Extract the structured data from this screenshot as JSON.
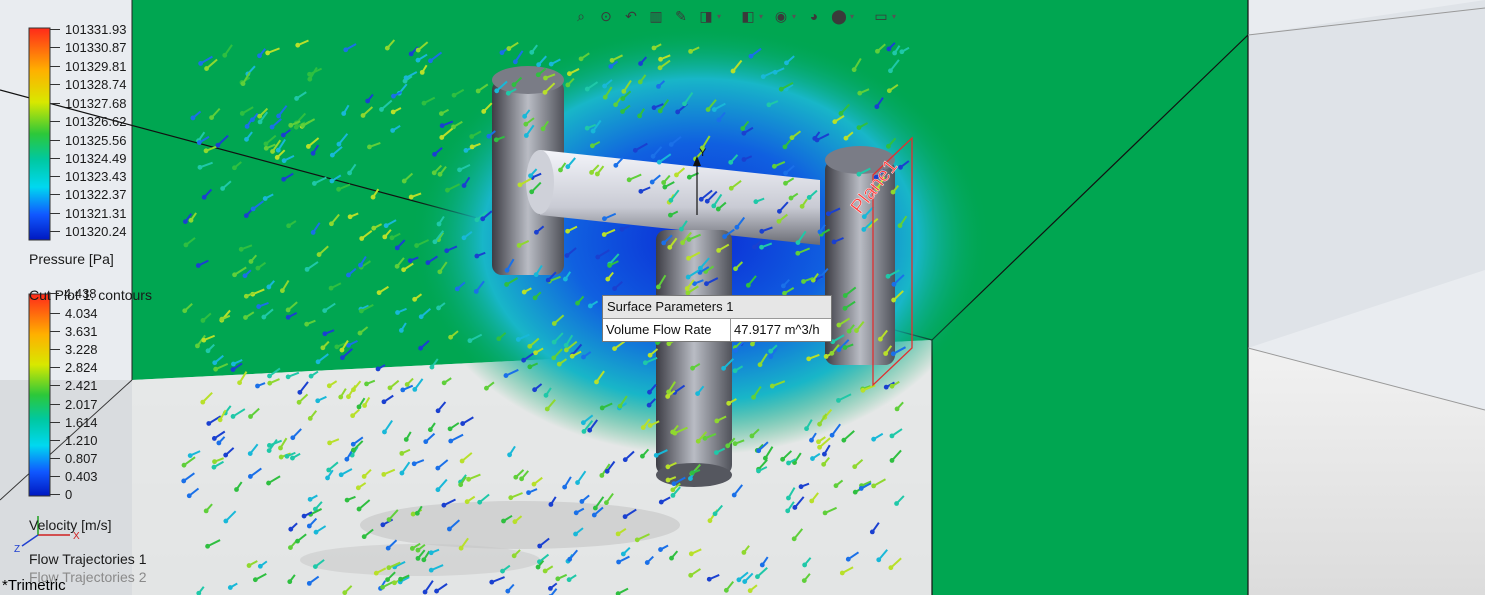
{
  "toolbar": {
    "icons": [
      "zoom-to-fit-icon",
      "zoom-to-area-icon",
      "previous-view-icon",
      "section-view-icon",
      "dynamic-annotation-icon",
      "view-orientation-icon",
      "display-style-icon",
      "hide-show-items-icon",
      "edit-appearance-icon",
      "apply-scene-icon",
      "view-settings-icon"
    ]
  },
  "pressure_legend": {
    "ticks": [
      "101331.93",
      "101330.87",
      "101329.81",
      "101328.74",
      "101327.68",
      "101326.62",
      "101325.56",
      "101324.49",
      "101323.43",
      "101322.37",
      "101321.31",
      "101320.24"
    ],
    "title": "Pressure [Pa]"
  },
  "velocity_legend": {
    "overlap_title_a": "Cut Plot 1: contours",
    "overlap_title_b": "4.438",
    "ticks": [
      "4.034",
      "3.631",
      "3.228",
      "2.824",
      "2.421",
      "2.017",
      "1.614",
      "1.210",
      "0.807",
      "0.403",
      "0"
    ],
    "title": "Velocity [m/s]"
  },
  "features": {
    "flow_traj_1": "Flow Trajectories 1",
    "flow_traj_2": "Flow Trajectories 2"
  },
  "callout": {
    "title": "Surface Parameters 1",
    "label": "Volume Flow Rate",
    "value": "47.9177 m^3/h"
  },
  "plane_label": "Plane1",
  "axis_label": "Y",
  "view_name": "*Trimetric",
  "colors": {
    "domain_green": "#00a651",
    "background": "#e9ecf0",
    "plane_red": "#e03030",
    "floor": "#e6e6e6"
  }
}
